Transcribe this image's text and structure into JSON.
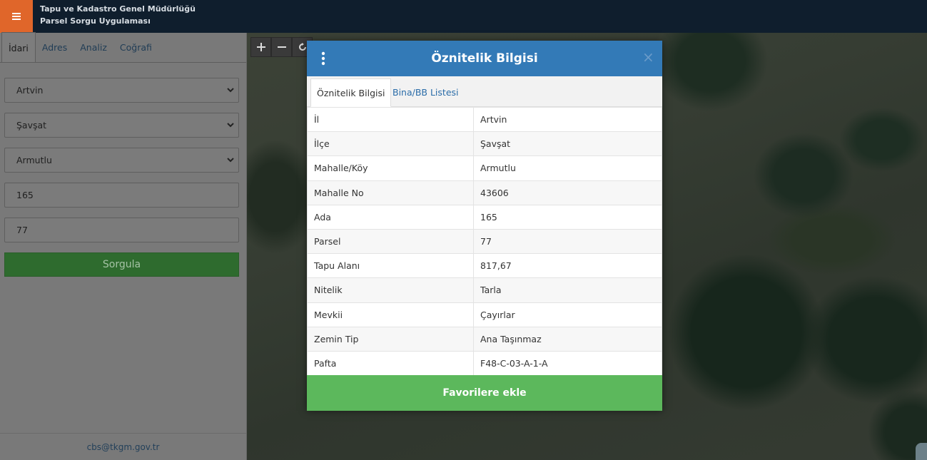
{
  "header": {
    "title_line1": "Tapu ve Kadastro Genel Müdürlüğü",
    "title_line2": "Parsel Sorgu Uygulaması",
    "menu_icon": "hamburger-icon",
    "accent_color": "#e0662a"
  },
  "sidebar": {
    "tabs": [
      {
        "label": "İdari",
        "active": true
      },
      {
        "label": "Adres",
        "active": false
      },
      {
        "label": "Analiz",
        "active": false
      },
      {
        "label": "Coğrafi",
        "active": false
      }
    ],
    "il_select": "Artvin",
    "ilce_select": "Şavşat",
    "mahalle_select": "Armutlu",
    "ada_input": "165",
    "parsel_input": "77",
    "query_button": "Sorgula",
    "footer_email": "cbs@tkgm.gov.tr"
  },
  "map": {
    "controls": [
      {
        "icon": "zoom-in-icon",
        "glyph": "+"
      },
      {
        "icon": "zoom-out-icon",
        "glyph": "−"
      },
      {
        "icon": "refresh-icon",
        "glyph": "⟳"
      }
    ]
  },
  "modal": {
    "title": "Öznitelik Bilgisi",
    "close_glyph": "×",
    "tabs": [
      "Öznitelik Bilgisi",
      "Bina/BB Listesi"
    ],
    "rows": [
      {
        "key": "İl",
        "value": "Artvin"
      },
      {
        "key": "İlçe",
        "value": "Şavşat"
      },
      {
        "key": "Mahalle/Köy",
        "value": "Armutlu"
      },
      {
        "key": "Mahalle No",
        "value": "43606"
      },
      {
        "key": "Ada",
        "value": "165"
      },
      {
        "key": "Parsel",
        "value": "77"
      },
      {
        "key": "Tapu Alanı",
        "value": "817,67"
      },
      {
        "key": "Nitelik",
        "value": "Tarla"
      },
      {
        "key": "Mevkii",
        "value": "Çayırlar"
      },
      {
        "key": "Zemin Tip",
        "value": "Ana Taşınmaz"
      },
      {
        "key": "Pafta",
        "value": "F48-C-03-A-1-A"
      }
    ],
    "favorite_button": "Favorilere ekle",
    "header_color": "#337ab7",
    "button_color": "#5cb85c"
  }
}
